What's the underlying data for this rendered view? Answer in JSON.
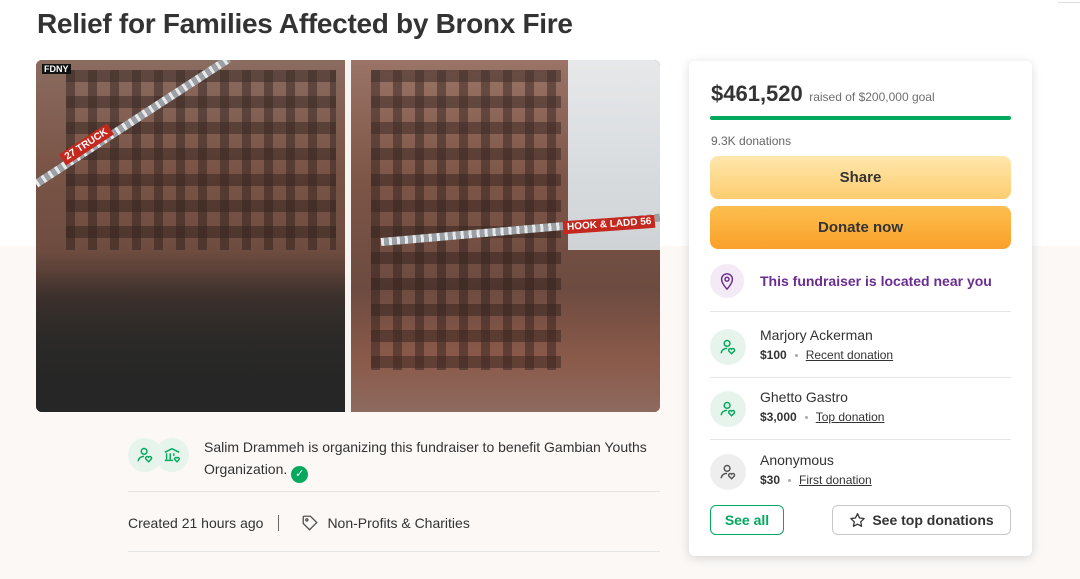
{
  "title": "Relief for Families Affected by Bronx Fire",
  "hero": {
    "left_photo_label": "FDNY",
    "ladder_label_left": "27 TRUCK",
    "ladder_label_right": "HOOK & LADD",
    "ladder_number": "56"
  },
  "organizer": {
    "text": "Salim Drammeh is organizing this fundraiser to benefit Gambian Youths Organization.",
    "created": "Created 21 hours ago",
    "category": "Non-Profits & Charities"
  },
  "donation_card": {
    "raised_amount": "$461,520",
    "goal_text": "raised of $200,000 goal",
    "progress_fraction": 1.0,
    "donations_count": "9.3K donations",
    "share_label": "Share",
    "donate_label": "Donate now",
    "near_text": "This fundraiser is located near you",
    "donors": [
      {
        "name": "Marjory Ackerman",
        "amount": "$100",
        "tag": "Recent donation"
      },
      {
        "name": "Ghetto Gastro",
        "amount": "$3,000",
        "tag": "Top donation"
      },
      {
        "name": "Anonymous",
        "amount": "$30",
        "tag": "First donation"
      }
    ],
    "see_all_label": "See all",
    "see_top_label": "See top donations"
  },
  "colors": {
    "brand_green": "#02a95c",
    "share_yellow": "#fdcd6f",
    "donate_orange": "#f9a02a",
    "location_purple": "#6a2c91"
  }
}
